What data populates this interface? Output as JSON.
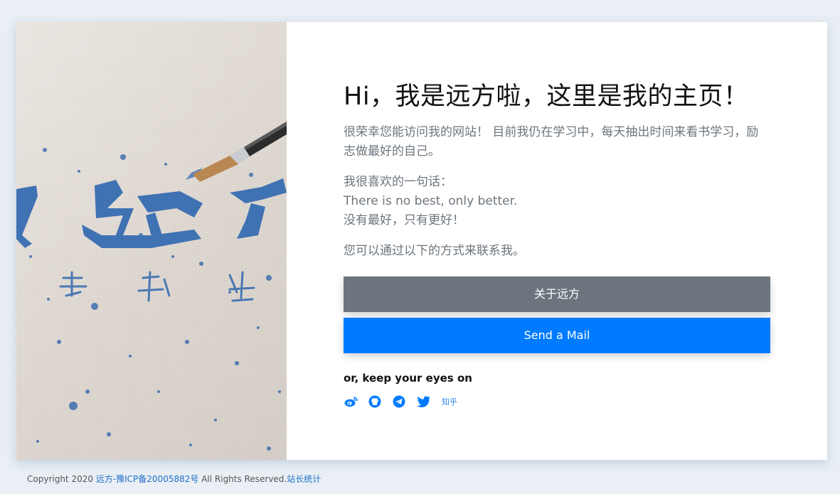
{
  "hero": {
    "image_alt": "calligraphy brush painting 远方 on canvas",
    "calligraphy_big": "远方",
    "calligraphy_small": [
      "美",
      "好",
      "生"
    ]
  },
  "main": {
    "title": "Hi，我是远方啦，这里是我的主页！",
    "intro": "很荣幸您能访问我的网站！ 目前我仍在学习中，每天抽出时间来看书学习，励志做最好的自己。",
    "quote_lead": "我很喜欢的一句话：",
    "quote_en": "There is no best, only better.",
    "quote_cn": "没有最好，只有更好！",
    "contact_line": "您可以通过以下的方式来联系我。"
  },
  "buttons": {
    "about": "关于远方",
    "mail": "Send a Mail"
  },
  "social": {
    "heading": "or, keep your eyes on",
    "icons": [
      "weibo-icon",
      "github-icon",
      "telegram-icon",
      "twitter-icon"
    ],
    "zhihu": "知乎",
    "accent": "#007bff"
  },
  "footer": {
    "copyright": "Copyright 2020 ",
    "icp": "远方-豫ICP备20005882号",
    "rights": " All Rights Reserved.",
    "stats": "站长统计"
  },
  "colors": {
    "background": "#e9eff4",
    "button_gray": "#6c757d",
    "button_blue": "#007bff",
    "ink_blue": "#3d6fae"
  }
}
